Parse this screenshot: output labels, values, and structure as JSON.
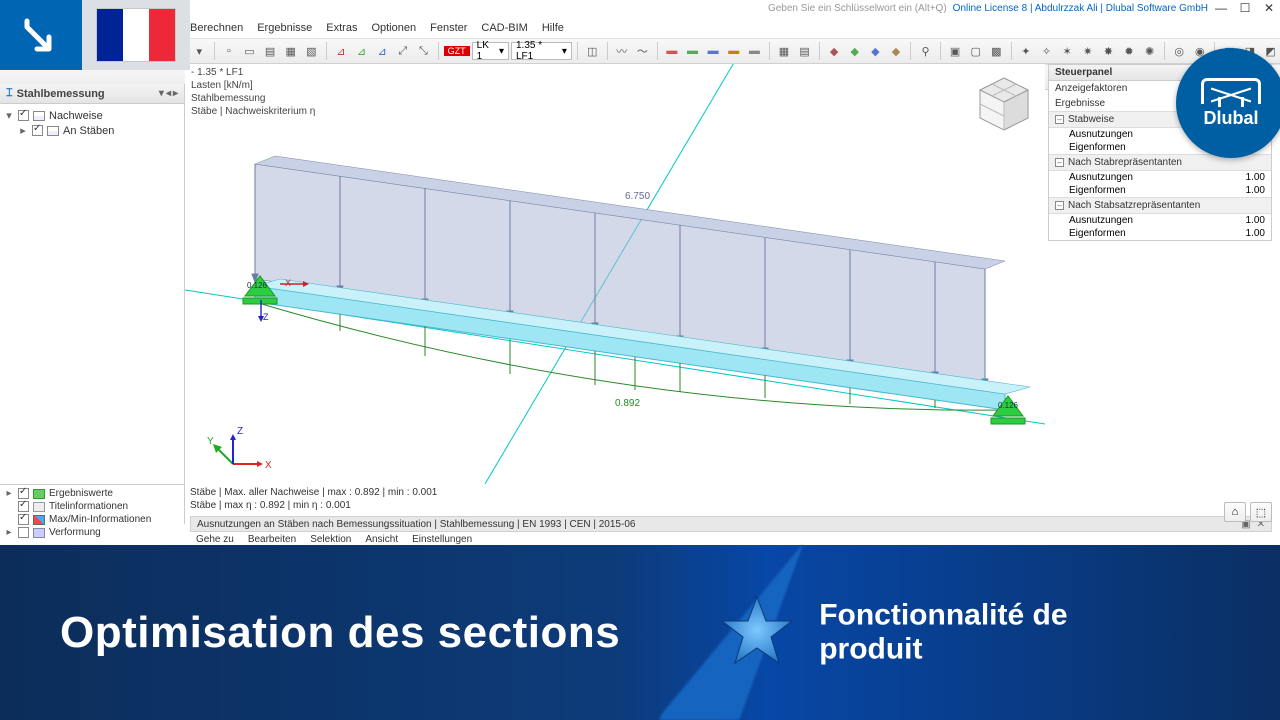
{
  "titlebar": {
    "search_hint": "Geben Sie ein Schlüsselwort ein (Alt+Q)",
    "license": "Online License 8 | Abdulrzzak Ali | Dlubal Software GmbH"
  },
  "menubar": [
    "Berechnen",
    "Ergebnisse",
    "Extras",
    "Optionen",
    "Fenster",
    "CAD-BIM",
    "Hilfe"
  ],
  "toolbar1": {
    "tag": "GZT",
    "combo1": "LK 1",
    "combo2": "1.35 * LF1"
  },
  "left": {
    "title": "Stahlbemessung",
    "tree": [
      {
        "expand": "▾",
        "checked": true,
        "label": "Nachweise"
      },
      {
        "expand": "▸",
        "checked": true,
        "label": "An Stäben",
        "indent": true
      }
    ]
  },
  "left_bottom": [
    {
      "icon": "val",
      "checked": true,
      "label": "Ergebniswerte"
    },
    {
      "icon": "title",
      "checked": true,
      "label": "Titelinformationen"
    },
    {
      "icon": "minmax",
      "checked": true,
      "label": "Max/Min-Informationen"
    },
    {
      "icon": "def",
      "checked": false,
      "label": "Verformung"
    }
  ],
  "viewport": {
    "lc_line": "- 1.35 * LF1",
    "line1": "Lasten [kN/m]",
    "line2": "Stahlbemessung",
    "line3": "Stäbe | Nachweiskriterium η",
    "load_value": "6.750",
    "result_value": "0.892",
    "support_a": "0.126",
    "support_b": "0.126",
    "footer1": "Stäbe | Max. aller Nachweise | max  : 0.892 | min  : 0.001",
    "footer2": "Stäbe | max η : 0.892 | min η : 0.001"
  },
  "resultbar": {
    "title": "Ausnutzungen an Stäben nach Bemessungssituation | Stahlbemessung | EN 1993 | CEN | 2015-06",
    "menu": [
      "Gehe zu",
      "Bearbeiten",
      "Selektion",
      "Ansicht",
      "Einstellungen"
    ]
  },
  "right": {
    "title": "Steuerpanel",
    "sec1a": "Anzeigefaktoren",
    "sec1b": "Ergebnisse",
    "g1": {
      "title": "Stabweise",
      "rows": [
        {
          "l": "Ausnutzungen",
          "v": ""
        },
        {
          "l": "Eigenformen",
          "v": ""
        }
      ]
    },
    "g2": {
      "title": "Nach Stabrepräsentanten",
      "rows": [
        {
          "l": "Ausnutzungen",
          "v": "1.00"
        },
        {
          "l": "Eigenformen",
          "v": "1.00"
        }
      ]
    },
    "g3": {
      "title": "Nach Stabsatzrepräsentanten",
      "rows": [
        {
          "l": "Ausnutzungen",
          "v": "1.00"
        },
        {
          "l": "Eigenformen",
          "v": "1.00"
        }
      ]
    }
  },
  "badge": {
    "label": "Dlubal"
  },
  "promo": {
    "title1": "Optimisation des sections",
    "title2a": "Fonctionnalité de",
    "title2b": "produit"
  },
  "flag_colors": [
    "#002395",
    "#ffffff",
    "#ED2939"
  ]
}
